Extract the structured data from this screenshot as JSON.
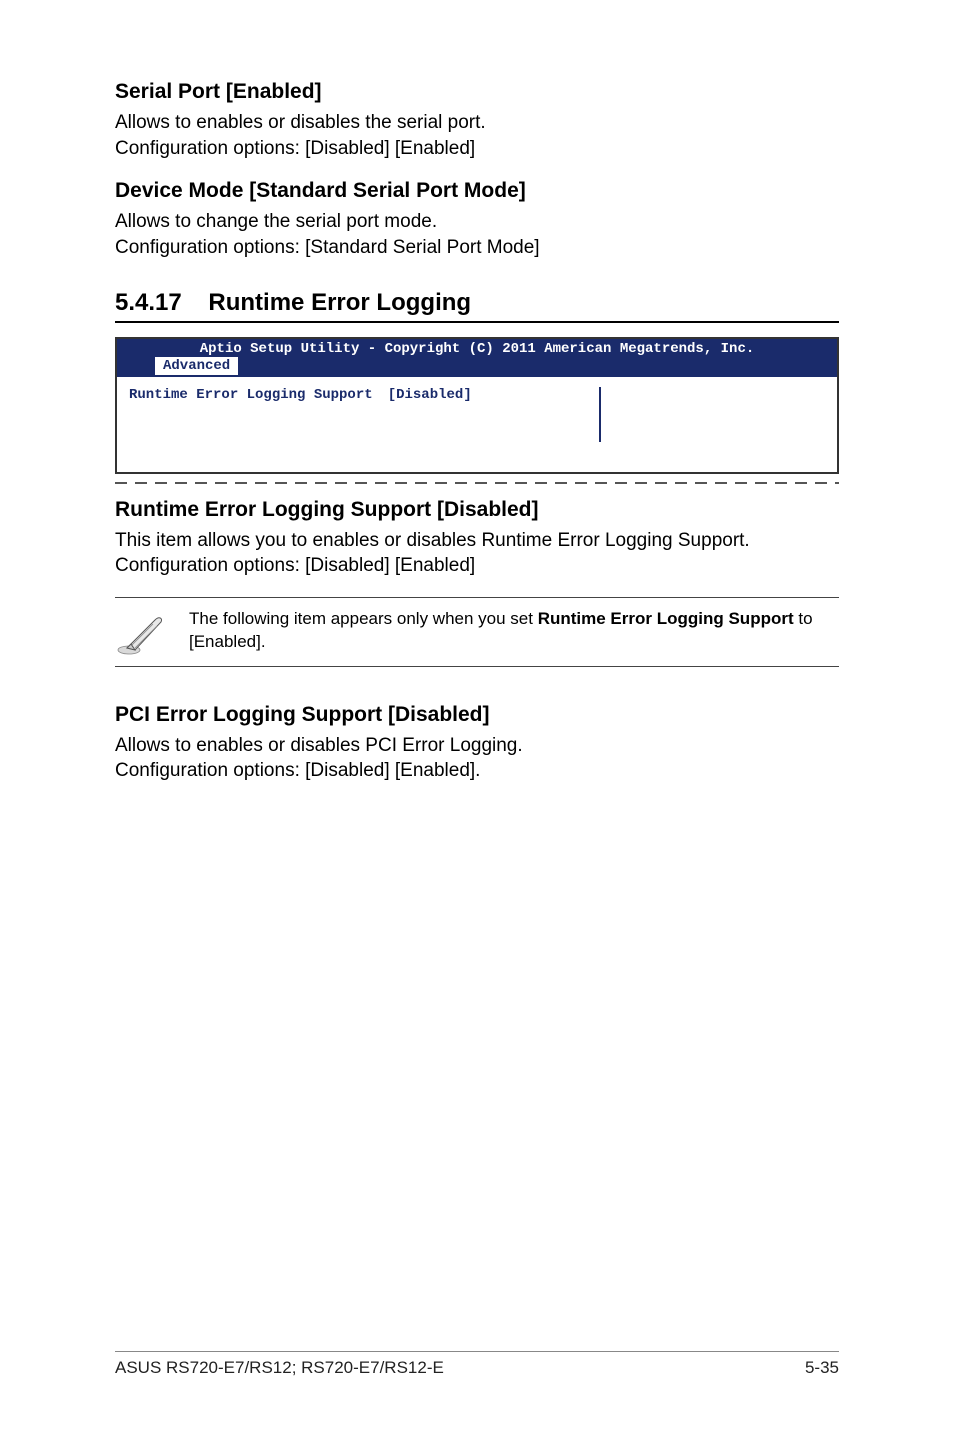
{
  "section1": {
    "heading": "Serial Port [Enabled]",
    "line1": "Allows to enables or disables the serial port.",
    "line2": "Configuration options: [Disabled] [Enabled]"
  },
  "section2": {
    "heading": "Device Mode [Standard Serial Port Mode]",
    "line1": "Allows to change the serial port mode.",
    "line2": "Configuration options: [Standard Serial Port Mode]"
  },
  "sectionMain": {
    "number": "5.4.17",
    "title": "Runtime Error Logging"
  },
  "bios": {
    "titleBar": "Aptio Setup Utility - Copyright (C) 2011 American Megatrends, Inc.",
    "tab": "Advanced",
    "rowLabel": "Runtime Error Logging Support",
    "rowValue": "[Disabled]"
  },
  "section3": {
    "heading": "Runtime Error Logging Support [Disabled]",
    "line1": "This item allows you to enables or disables Runtime Error Logging Support.",
    "line2": "Configuration options: [Disabled] [Enabled]"
  },
  "note": {
    "prefix": "The following item appears only when you set ",
    "bold": "Runtime Error Logging Support",
    "suffix": " to [Enabled]."
  },
  "section4": {
    "heading": "PCI Error Logging Support [Disabled]",
    "line1": "Allows to enables or disables PCI Error Logging.",
    "line2": "Configuration options: [Disabled] [Enabled]."
  },
  "footer": {
    "left": "ASUS RS720-E7/RS12; RS720-E7/RS12-E",
    "right": "5-35"
  }
}
